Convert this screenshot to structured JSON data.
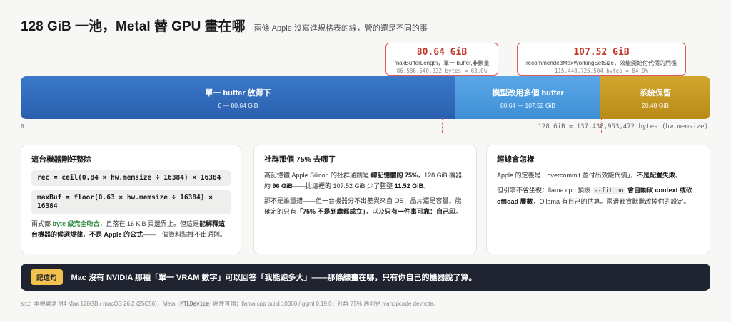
{
  "header": {
    "title": "128 GiB 一池，Metal 替 GPU 畫在哪",
    "subtitle": "兩條 Apple 沒寫進規格表的線，管的還是不同的事"
  },
  "callouts": [
    {
      "value": "80.64 GiB",
      "desc": "maxBufferLength，單一 buffer,非鎖量",
      "bytes": "86,586,540,032 bytes = 63.0%"
    },
    {
      "value": "107.52 GiB",
      "desc": "recommendedMaxWorkingSetSize，效能開始付代價的門檻",
      "bytes": "115,448,725,504 bytes = 84.0%"
    }
  ],
  "bar": {
    "segments": [
      {
        "label": "單一 buffer 放得下",
        "range": "0 — 80.64 GiB",
        "fraction": 0.63,
        "color": "#2a5fae"
      },
      {
        "label": "模型改用多個 buffer",
        "range": "80.64 — 107.52 GiB",
        "fraction": 0.21,
        "color": "#3f8fd6"
      },
      {
        "label": "系統保留",
        "range": "20.48 GiB",
        "fraction": 0.16,
        "color": "#b88b17"
      }
    ],
    "axis_zero": "0",
    "axis_total": "128 GiB = 137,438,953,472 bytes (hw.memsize)"
  },
  "cards": {
    "card1": {
      "title": "這台機器剛好整除",
      "code1": "rec = ceil(0.84 × hw.memsize ÷ 16384) × 16384",
      "code2": "maxBuf = floor(0.63 × hw.memsize ÷ 16384) × 16384",
      "p_a": "兩式都 ",
      "p_b": "byte 級完全吻合",
      "p_c": "，且落在 16 KiB 頁邊界上。但這是",
      "p_d": "能解釋這台機器的候選規律",
      "p_e": "，",
      "p_f": "不是 Apple 的公式",
      "p_g": "——一個資料點推不出通則。"
    },
    "card2": {
      "title": "社群那個 75% 去哪了",
      "p1_a": "高記憶體 Apple Silicon 的社群通則是 ",
      "p1_b": "總記憶體的 75%",
      "p1_c": "，128 GiB 機器約 ",
      "p1_d": "96 GiB",
      "p1_e": "——比這裡的 107.52 GiB 少了整整 ",
      "p1_f": "11.52 GiB",
      "p1_g": "。",
      "p2_a": "那不是誰量錯——但一台機器分不出差異來自 OS、晶片還是容量。能確定的只有",
      "p2_b": "「75% 不是到處都成立」",
      "p2_c": "，以及",
      "p2_d": "只有一件事可靠：自己印",
      "p2_e": "。"
    },
    "card3": {
      "title": "超線會怎樣",
      "p1_a": "Apple 的定義是「overcommit 並付出效能代價」，",
      "p1_b": "不是配置失敗",
      "p1_c": "。",
      "p2_a": "但引擎不會坐視：llama.cpp 預設 ",
      "p2_code": "--fit on",
      "p2_b": " 會自動砍 context 或砍 offload 層數",
      "p2_c": "，Ollama 有自己的估算。兩邊都會默默改掉你的設定。"
    }
  },
  "banner": {
    "tag": "記這句",
    "text": "Mac 沒有 NVIDIA 那種「單一 VRAM 數字」可以回答「我能跑多大」——那條線畫在哪，只有你自己的機器說了算。"
  },
  "footer": {
    "a": "src：本機實測 M4 Max 128GB / macOS 26.2 (25C56)，Metal ",
    "code": "MTLDevice",
    "b": " 屬性直讀；llama.cpp build 10360 / ggml 0.19.0；社群 75% 通則見 lvanopcode devnote。"
  }
}
